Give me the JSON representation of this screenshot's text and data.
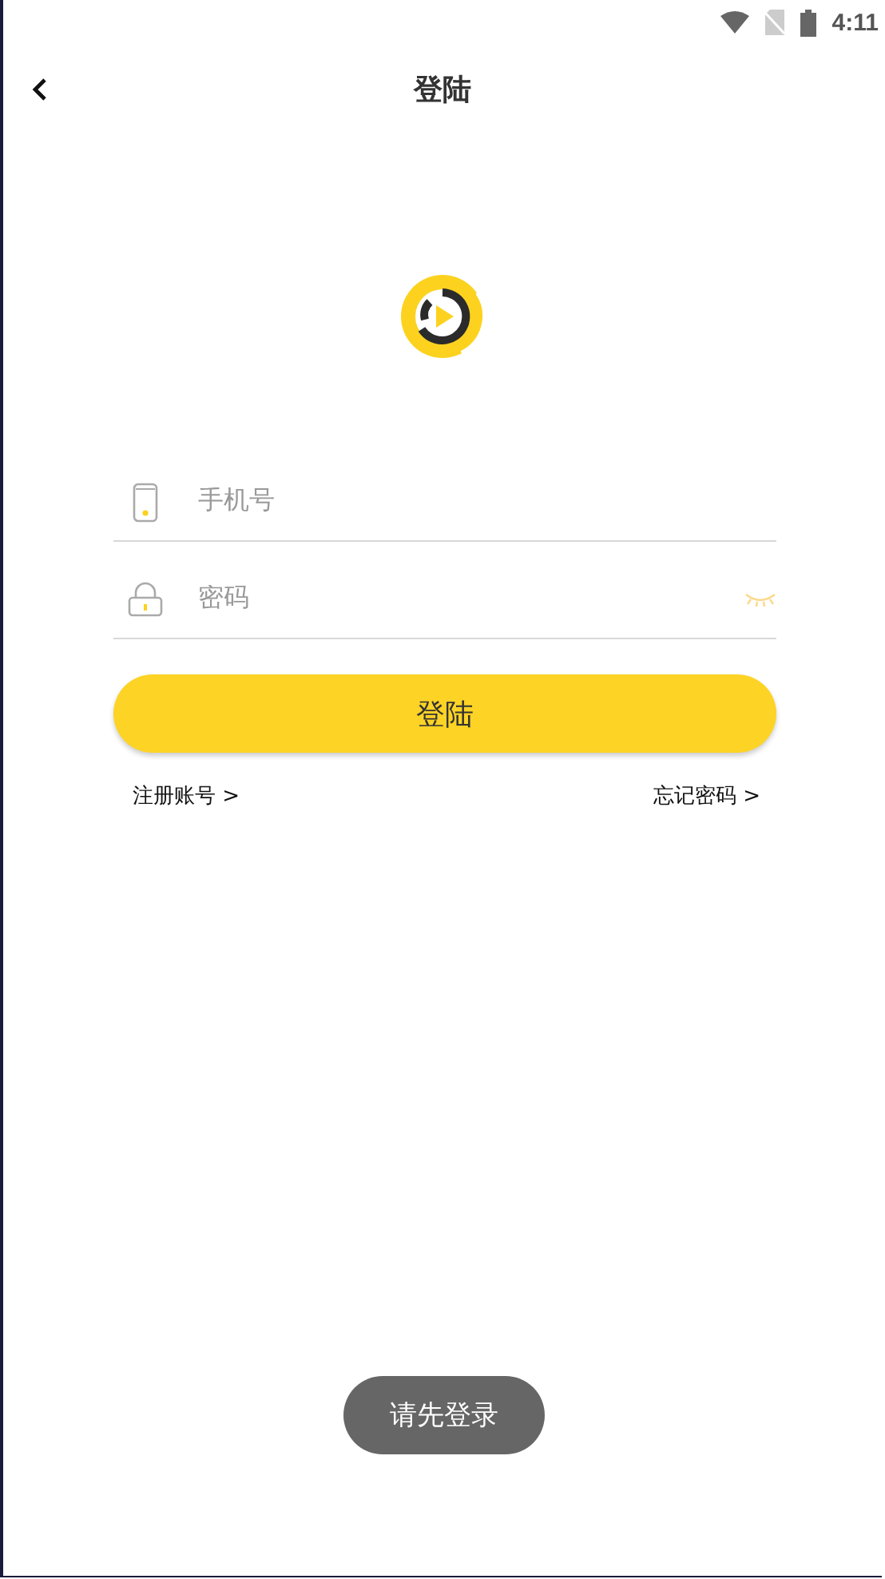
{
  "status_bar": {
    "time": "4:11"
  },
  "header": {
    "title": "登陆"
  },
  "form": {
    "phone": {
      "placeholder": "手机号"
    },
    "password": {
      "placeholder": "密码",
      "visible": false
    }
  },
  "login_button": "登陆",
  "links": [
    "注册账号 >",
    "忘记密码 >"
  ],
  "toast": "请先登录"
}
